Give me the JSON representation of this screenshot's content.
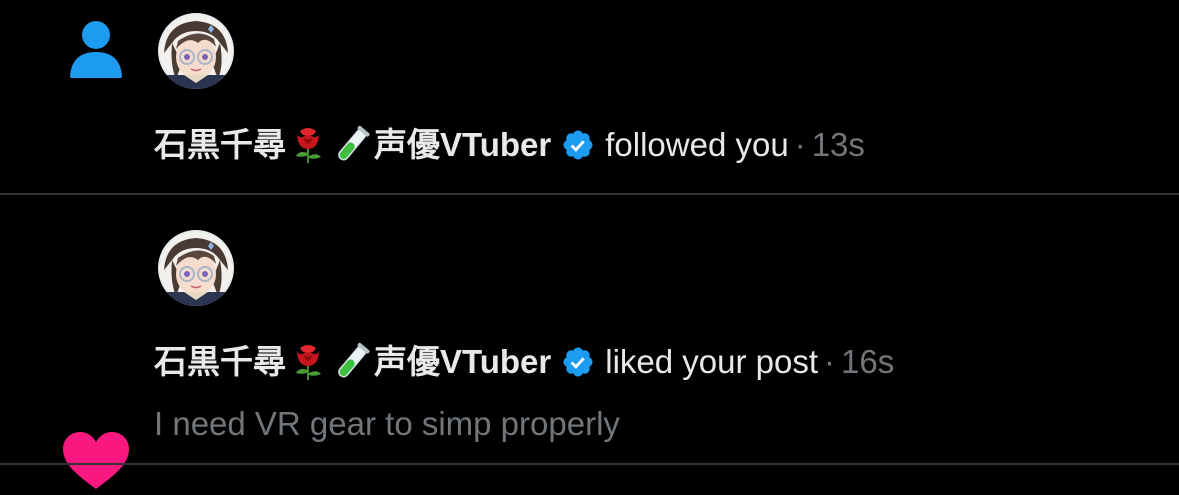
{
  "notifications": [
    {
      "type_icon": "person-icon",
      "user": {
        "name_cjk": "石黒千尋",
        "emoji_1": "rose-emoji",
        "emoji_2": "test-tube-emoji",
        "name_suffix": "声優VTuber",
        "verified": true
      },
      "action": "followed you",
      "separator": "·",
      "time": "13s"
    },
    {
      "type_icon": "heart-icon",
      "user": {
        "name_cjk": "石黒千尋",
        "emoji_1": "rose-emoji",
        "emoji_2": "test-tube-emoji",
        "name_suffix": "声優VTuber",
        "verified": true
      },
      "action": "liked your post",
      "separator": "·",
      "time": "16s",
      "post_text": "I need VR gear to simp properly"
    }
  ],
  "colors": {
    "background": "#000000",
    "primary_text": "#e7e9ea",
    "secondary_text": "#71767b",
    "follow_icon": "#1d9bf0",
    "like_icon": "#f91880",
    "verified_badge": "#1d9bf0",
    "divider": "#2f3336"
  }
}
